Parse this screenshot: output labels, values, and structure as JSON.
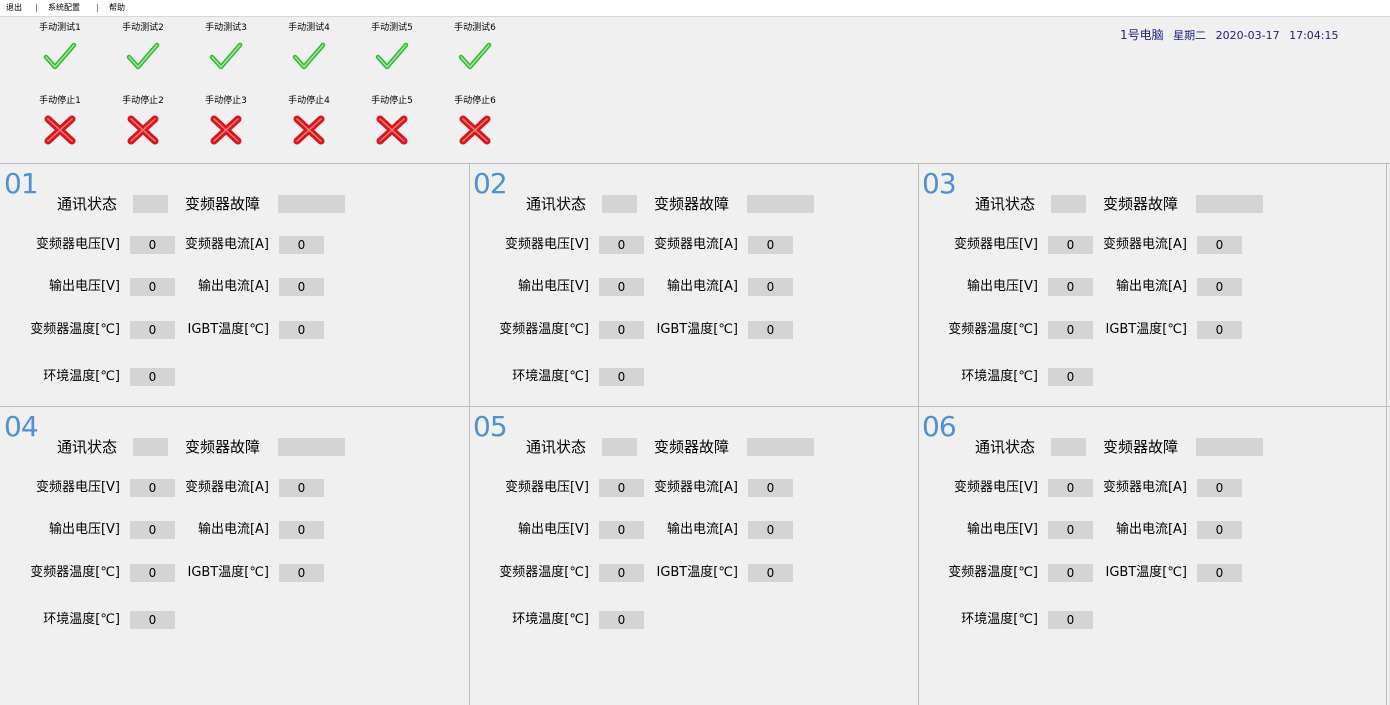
{
  "menu": {
    "items": [
      "退出",
      "系统配置",
      "帮助"
    ]
  },
  "test_controls": [
    {
      "label": "手动测试1"
    },
    {
      "label": "手动测试2"
    },
    {
      "label": "手动测试3"
    },
    {
      "label": "手动测试4"
    },
    {
      "label": "手动测试5"
    },
    {
      "label": "手动测试6"
    }
  ],
  "stop_controls": [
    {
      "label": "手动停止1"
    },
    {
      "label": "手动停止2"
    },
    {
      "label": "手动停止3"
    },
    {
      "label": "手动停止4"
    },
    {
      "label": "手动停止5"
    },
    {
      "label": "手动停止6"
    }
  ],
  "icons": {
    "test": "check-icon",
    "stop": "cross-icon"
  },
  "colors": {
    "check": "#34b634",
    "cross": "#d8161c",
    "number": "#4f90d6",
    "status": "#1f1c8a"
  },
  "status": {
    "pc": "1号电脑",
    "weekday": "星期二",
    "date": "2020-03-17",
    "time": "17:04:15"
  },
  "labels": {
    "comm_status": "通讯状态",
    "vfd_fault": "变频器故障",
    "vfd_voltage": "变频器电压[V]",
    "vfd_current": "变频器电流[A]",
    "out_voltage": "输出电压[V]",
    "out_current": "输出电流[A]",
    "vfd_temp": "变频器温度[℃]",
    "igbt_temp": "IGBT温度[℃]",
    "env_temp": "环境温度[℃]"
  },
  "panels": [
    {
      "number": "01",
      "comm_status": "",
      "vfd_fault": "",
      "vfd_voltage": "0",
      "vfd_current": "0",
      "out_voltage": "0",
      "out_current": "0",
      "vfd_temp": "0",
      "igbt_temp": "0",
      "env_temp": "0"
    },
    {
      "number": "02",
      "comm_status": "",
      "vfd_fault": "",
      "vfd_voltage": "0",
      "vfd_current": "0",
      "out_voltage": "0",
      "out_current": "0",
      "vfd_temp": "0",
      "igbt_temp": "0",
      "env_temp": "0"
    },
    {
      "number": "03",
      "comm_status": "",
      "vfd_fault": "",
      "vfd_voltage": "0",
      "vfd_current": "0",
      "out_voltage": "0",
      "out_current": "0",
      "vfd_temp": "0",
      "igbt_temp": "0",
      "env_temp": "0"
    },
    {
      "number": "04",
      "comm_status": "",
      "vfd_fault": "",
      "vfd_voltage": "0",
      "vfd_current": "0",
      "out_voltage": "0",
      "out_current": "0",
      "vfd_temp": "0",
      "igbt_temp": "0",
      "env_temp": "0"
    },
    {
      "number": "05",
      "comm_status": "",
      "vfd_fault": "",
      "vfd_voltage": "0",
      "vfd_current": "0",
      "out_voltage": "0",
      "out_current": "0",
      "vfd_temp": "0",
      "igbt_temp": "0",
      "env_temp": "0"
    },
    {
      "number": "06",
      "comm_status": "",
      "vfd_fault": "",
      "vfd_voltage": "0",
      "vfd_current": "0",
      "out_voltage": "0",
      "out_current": "0",
      "vfd_temp": "0",
      "igbt_temp": "0",
      "env_temp": "0"
    }
  ]
}
